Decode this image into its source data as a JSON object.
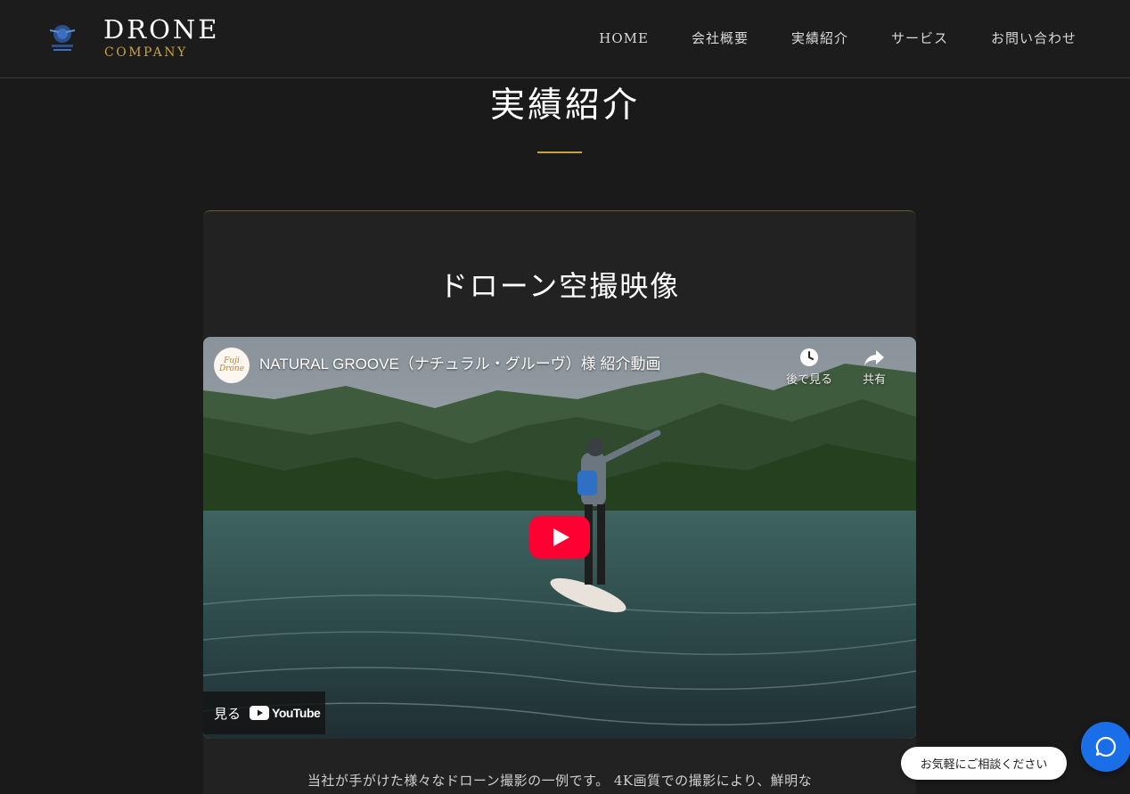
{
  "header": {
    "logo_word": "DRONE",
    "logo_sub": "COMPANY",
    "nav": [
      "HOME",
      "会社概要",
      "実績紹介",
      "サービス",
      "お問い合わせ"
    ]
  },
  "page": {
    "title": "実績紹介"
  },
  "card": {
    "title": "ドローン空撮映像",
    "description": "当社が手がけた様々なドローン撮影の一例です。 4K画質での撮影により、鮮明な"
  },
  "video": {
    "channel_avatar_text": "Fuji Drone",
    "title": "NATURAL GROOVE（ナチュラル・グルーヴ）様 紹介動画",
    "watch_later_label": "後で見る",
    "share_label": "共有",
    "watch_on_label": "見る",
    "youtube_label": "YouTube"
  },
  "chat": {
    "prompt": "お気軽にご相談ください"
  },
  "colors": {
    "accent_gold": "#c9a23a",
    "background": "#1a1a1a",
    "youtube_red": "#ff0033",
    "chat_blue": "#1a6fe8"
  }
}
